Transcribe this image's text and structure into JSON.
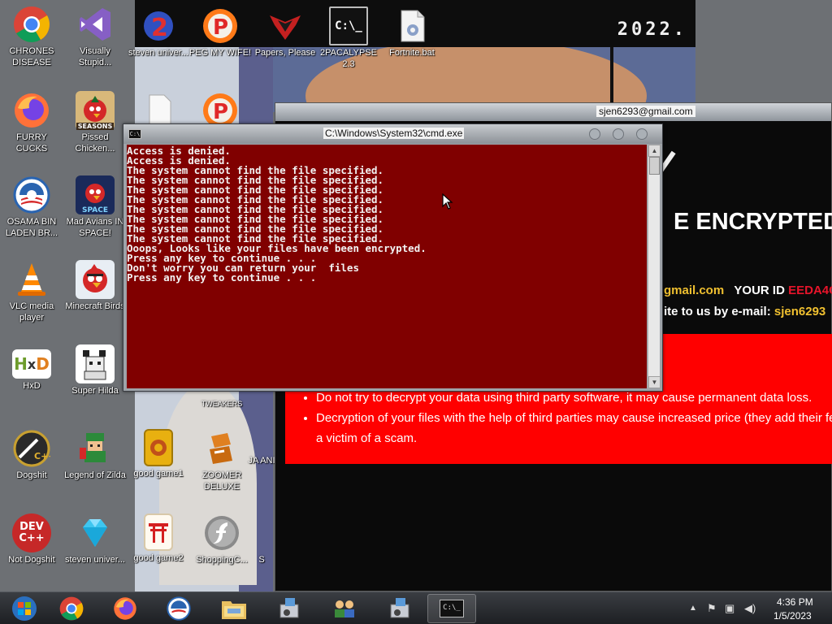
{
  "desktop": {
    "col1": [
      {
        "label": "CHRONES DISEASE",
        "icon": "chrome-icon"
      },
      {
        "label": "FURRY CUCKS",
        "icon": "firefox-icon"
      },
      {
        "label": "OSAMA BIN LADEN BR...",
        "icon": "obama-logo-icon"
      },
      {
        "label": "VLC media player",
        "icon": "vlc-cone-icon"
      },
      {
        "label": "HxD",
        "icon": "hxd-icon"
      },
      {
        "label": "Dogshit",
        "icon": "codeblocks-icon"
      },
      {
        "label": "Not Dogshit",
        "icon": "devcpp-icon",
        "icon_text": "DEV C++"
      }
    ],
    "col2": [
      {
        "label": "Visually Stupid...",
        "icon": "visual-studio-icon"
      },
      {
        "label": "Pissed Chicken...",
        "icon": "angry-birds-seasons-icon",
        "icon_text": "SEASONS"
      },
      {
        "label": "Mad Avians IN SPACE!",
        "icon": "angry-birds-space-icon",
        "icon_text": "SPACE"
      },
      {
        "label": "Minecraft Birds",
        "icon": "angry-bird-icon"
      },
      {
        "label": "Super Hilda",
        "icon": "pixel-dog-icon"
      },
      {
        "label": "Legend of Zilda",
        "icon": "pixel-hero-icon"
      },
      {
        "label": "steven univer...",
        "icon": "diamond-icon"
      }
    ],
    "top_row": [
      {
        "label": "steven univer...",
        "icon": "number-2-icon"
      },
      {
        "label": "PEG MY WIFE!",
        "icon": "p-ball-icon"
      },
      {
        "label": "Papers, Please",
        "icon": "papers-please-icon"
      },
      {
        "label": "2PACALYPSE 2.3",
        "icon": "cmd-icon"
      },
      {
        "label": "Fortnite.bat",
        "icon": "batch-file-icon"
      }
    ],
    "col3": [
      {
        "label": "",
        "icon": "document-icon"
      },
      {
        "label": "good game1",
        "icon": "mahjong-tile-icon"
      },
      {
        "label": "good game2",
        "icon": "torii-tile-icon"
      }
    ],
    "col4": [
      {
        "label": "TWEAKERS",
        "icon": "tweakers-icon"
      },
      {
        "label": "ZOOMER DELUXE",
        "icon": "zoomer-blocks-icon"
      },
      {
        "label": "ShoppingC...",
        "icon": "flash-icon"
      }
    ],
    "col5": [
      {
        "label": "JA ANI",
        "icon": "partial-icon"
      },
      {
        "label": "S",
        "icon": "partial-icon"
      }
    ],
    "banner_year": "2022."
  },
  "ransom": {
    "title": "sjen6293@gmail.com",
    "heading": "E ENCRYPTED",
    "line1_a": "gmail.com",
    "line1_b": "YOUR ID",
    "line1_c": "EEDA4C",
    "line2_a": "ite to us by e-mail:",
    "line2_b": "sjen6293",
    "bullets": [
      "Do not try to decrypt your data using third party software, it may cause permanent data loss.",
      "Decryption of your files with the help of third parties may cause increased price (they add their fee",
      "a victim of a scam."
    ]
  },
  "cmd": {
    "title": "C:\\Windows\\System32\\cmd.exe",
    "lines": [
      "Access is denied.",
      "Access is denied.",
      "The system cannot find the file specified.",
      "The system cannot find the file specified.",
      "The system cannot find the file specified.",
      "The system cannot find the file specified.",
      "The system cannot find the file specified.",
      "The system cannot find the file specified.",
      "The system cannot find the file specified.",
      "The system cannot find the file specified.",
      "Ooops, Looks like your files have been encrypted.",
      "Press any key to continue . . .",
      "Don't worry you can return your  files",
      "Press any key to continue . . ."
    ]
  },
  "taskbar": {
    "items": [
      "start-orb-icon",
      "chrome-icon",
      "firefox-icon",
      "obama-logo-icon",
      "file-explorer-icon",
      "installer-icon",
      "network-users-icon",
      "installer-icon",
      "cmd-icon"
    ],
    "time": "4:36 PM",
    "date": "1/5/2023"
  },
  "colors": {
    "console_bg": "#800000",
    "ransom_red": "#ff0000",
    "ransom_gold": "#f0c030"
  }
}
